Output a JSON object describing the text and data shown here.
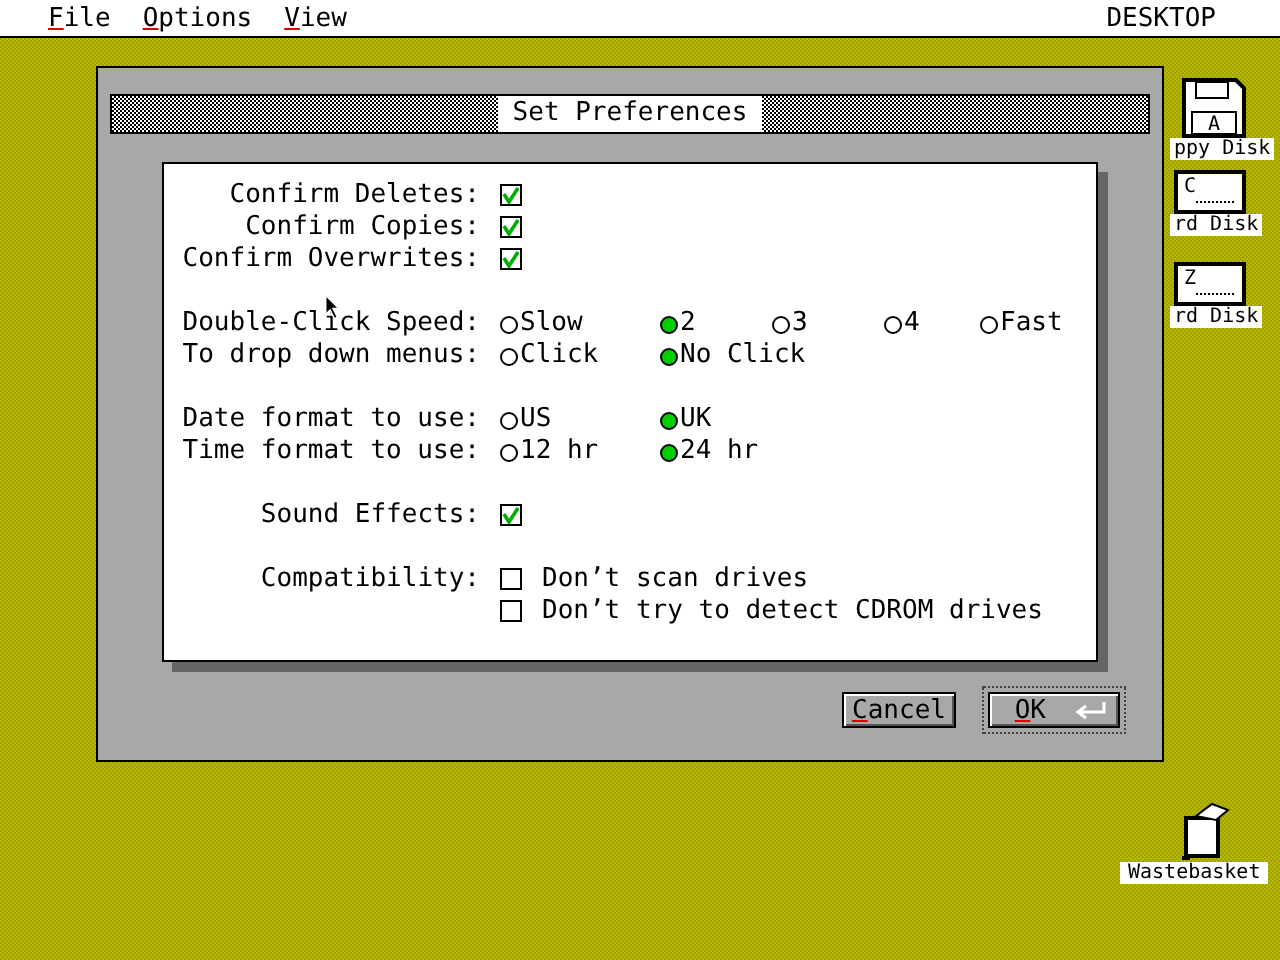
{
  "menu_bar": {
    "items": [
      {
        "label": "File"
      },
      {
        "label": "Options"
      },
      {
        "label": "View"
      }
    ],
    "title": "DESKTOP"
  },
  "desktop_icons": [
    {
      "kind": "floppy",
      "letter": "A",
      "label": "ppy Disk"
    },
    {
      "kind": "hard_disk",
      "letter": "C",
      "label": "rd Disk"
    },
    {
      "kind": "hard_disk",
      "letter": "Z",
      "label": "rd Disk"
    },
    {
      "kind": "trash",
      "label": "Wastebasket"
    }
  ],
  "dialog": {
    "title": "Set Preferences",
    "groups": [
      {
        "rows": [
          {
            "kind": "checkbox",
            "label": "Confirm Deletes:",
            "checked": true
          },
          {
            "kind": "checkbox",
            "label": "Confirm Copies:",
            "checked": true
          },
          {
            "kind": "checkbox",
            "label": "Confirm Overwrites:",
            "checked": true
          }
        ]
      },
      {
        "rows": [
          {
            "kind": "radio",
            "label": "Double-Click Speed:",
            "options": [
              {
                "label": "Slow",
                "selected": false
              },
              {
                "label": "2",
                "selected": true
              },
              {
                "label": "3",
                "selected": false
              },
              {
                "label": "4",
                "selected": false
              },
              {
                "label": "Fast",
                "selected": false
              }
            ]
          },
          {
            "kind": "radio",
            "label": "To drop down menus:",
            "options": [
              {
                "label": "Click",
                "selected": false
              },
              {
                "label": "No Click",
                "selected": true
              }
            ]
          }
        ]
      },
      {
        "rows": [
          {
            "kind": "radio",
            "label": "Date format to use:",
            "options": [
              {
                "label": "US",
                "selected": false
              },
              {
                "label": "UK",
                "selected": true
              }
            ]
          },
          {
            "kind": "radio",
            "label": "Time format to use:",
            "options": [
              {
                "label": "12 hr",
                "selected": false
              },
              {
                "label": "24 hr",
                "selected": true
              }
            ]
          }
        ]
      },
      {
        "rows": [
          {
            "kind": "checkbox",
            "label": "Sound Effects:",
            "checked": true
          }
        ]
      },
      {
        "rows": [
          {
            "kind": "checklist",
            "label": "Compatibility:",
            "options": [
              {
                "label": "Don’t scan drives",
                "checked": false
              },
              {
                "label": "Don’t try to detect CDROM drives",
                "checked": false
              }
            ]
          }
        ]
      }
    ],
    "buttons": [
      {
        "label": "Cancel",
        "default": false
      },
      {
        "label": "OK",
        "default": true
      }
    ]
  }
}
